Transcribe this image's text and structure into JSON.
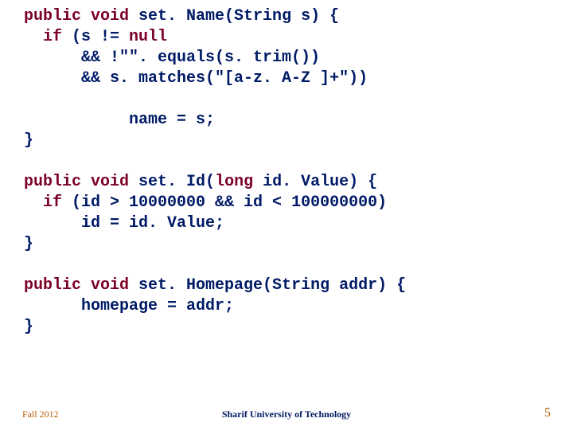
{
  "code": {
    "l1a": "public void",
    "l1b": " set. Name(String s) {",
    "l2a": "  if",
    "l2b": " (s != ",
    "l2c": "null",
    "l3": "      && !\"\". equals(s. trim())",
    "l4": "      && s. matches(\"[a-z. A-Z ]+\"))",
    "l5": "           name = s;",
    "l6": "}",
    "l7a": "public void",
    "l7b": " set. Id(",
    "l7c": "long",
    "l7d": " id. Value) {",
    "l8a": "  if",
    "l8b": " (id > 10000000 && id < 100000000)",
    "l9": "      id = id. Value;",
    "l10": "}",
    "l11a": "public void",
    "l11b": " set. Homepage(String addr) {",
    "l12": "      homepage = addr;",
    "l13": "}"
  },
  "footer": {
    "left": "Fall 2012",
    "center": "Sharif University of Technology",
    "right": "5"
  }
}
